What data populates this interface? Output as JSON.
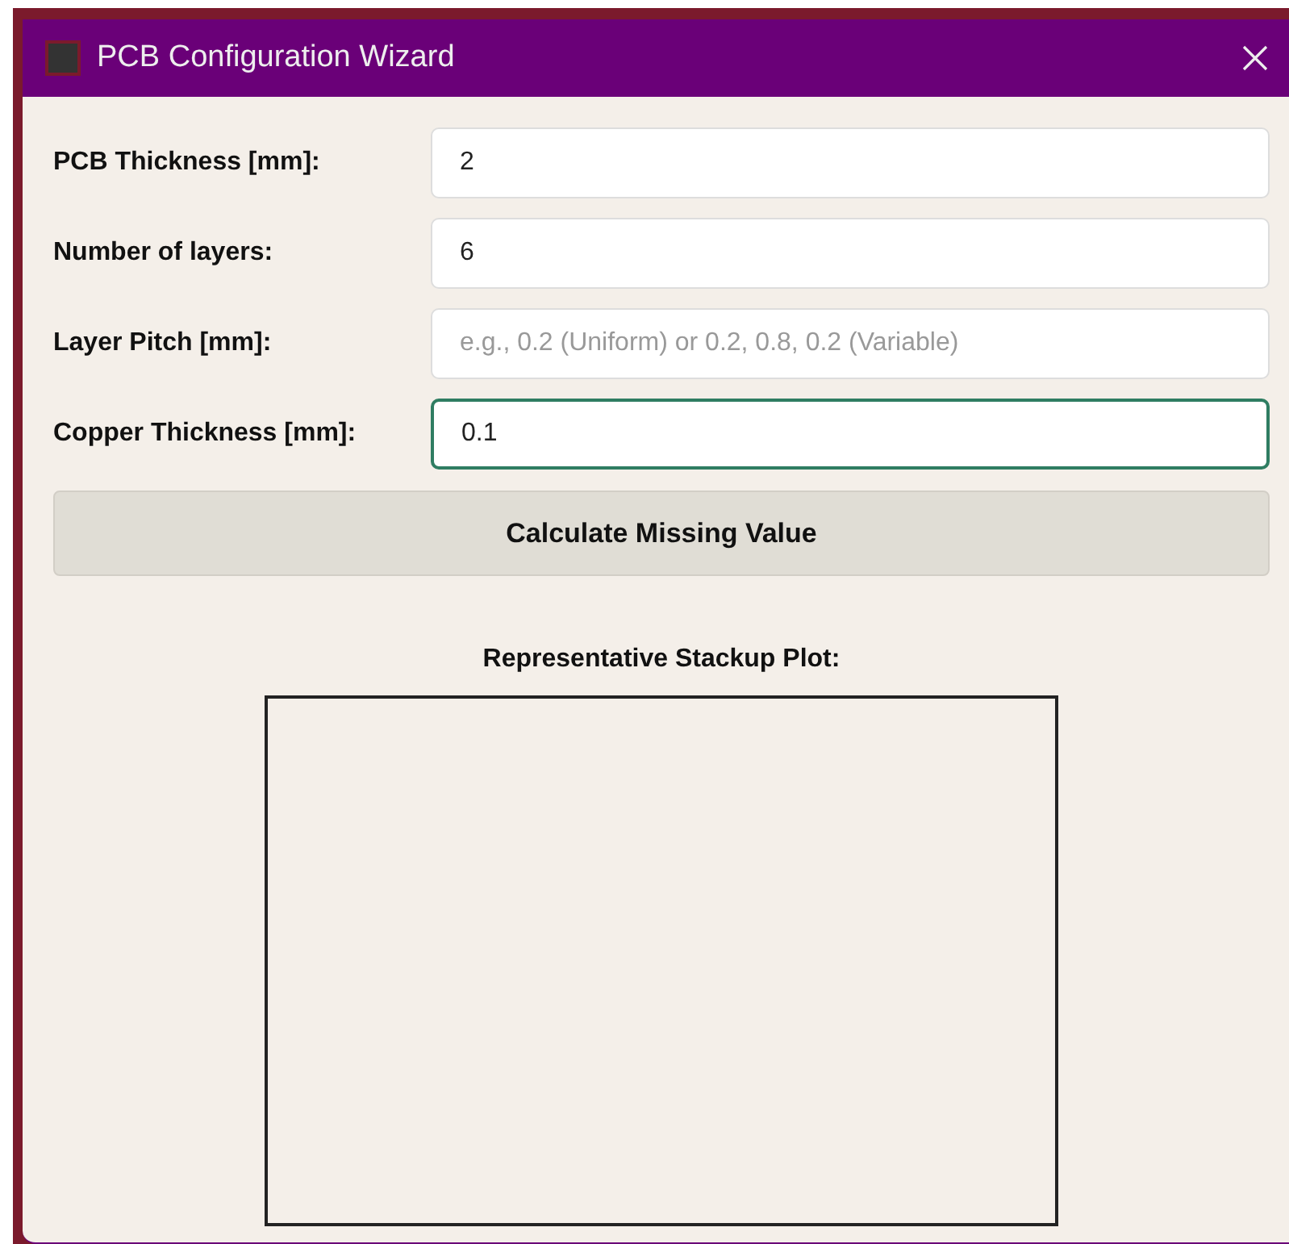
{
  "window": {
    "title": "PCB Configuration Wizard"
  },
  "fields": [
    {
      "label": "PCB Thickness [mm]:",
      "value": "2",
      "focused": false
    },
    {
      "label": "Number of layers:",
      "value": "6",
      "focused": false
    },
    {
      "label": "Layer Pitch [mm]:",
      "placeholder": "e.g., 0.2 (Uniform) or 0.2, 0.8, 0.2 (Variable)",
      "focused": false
    },
    {
      "label": "Copper Thickness [mm]:",
      "value": "0.1",
      "focused": true
    }
  ],
  "calculate_button": "Calculate Missing Value",
  "plot": {
    "title": "Representative Stackup Plot:"
  }
}
